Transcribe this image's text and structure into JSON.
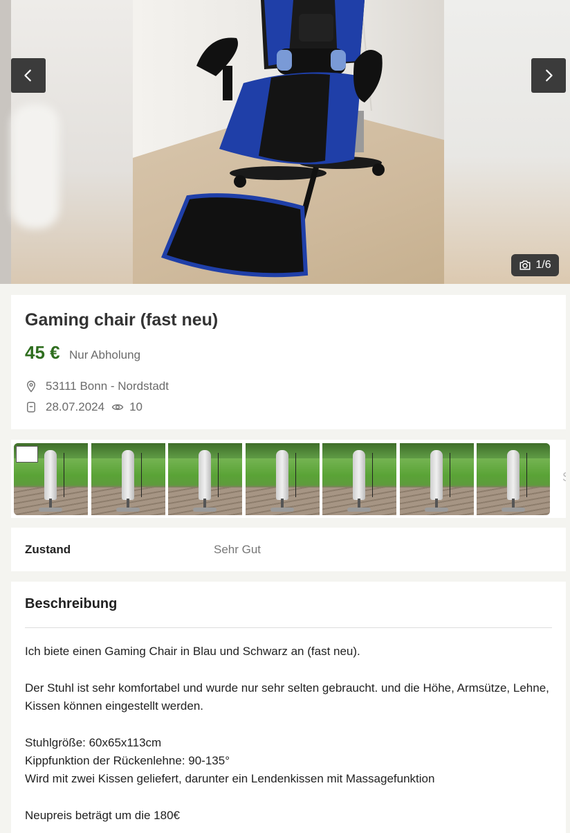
{
  "gallery": {
    "counter": "1/6",
    "prev_icon": "chevron-left-icon",
    "next_icon": "chevron-right-icon",
    "camera_icon": "camera-icon"
  },
  "listing": {
    "title": "Gaming chair (fast neu)",
    "price": "45 €",
    "shipping": "Nur Abholung",
    "location": "53111 Bonn - Nordstadt",
    "date": "28.07.2024",
    "views": "10"
  },
  "thumbnails": {
    "count": 7,
    "more_hint": "S"
  },
  "details": {
    "condition_label": "Zustand",
    "condition_value": "Sehr Gut"
  },
  "description": {
    "heading": "Beschreibung",
    "lines": [
      "Ich biete einen Gaming Chair in Blau und Schwarz an (fast neu).",
      "Der Stuhl ist sehr komfortabel und wurde nur sehr selten gebraucht. und die Höhe, Armsütze, Lehne, Kissen können eingestellt werden.",
      "Stuhlgröße: 60x65x113cm",
      "Kippfunktion der Rückenlehne: 90-135°",
      "Wird mit zwei Kissen geliefert, darunter ein Lendenkissen mit Massagefunktion",
      "Neupreis beträgt um die 180€"
    ]
  },
  "colors": {
    "price": "#2f6e1f",
    "nav_button": "#3b3b3b",
    "chair_blue": "#1f3fa8"
  }
}
